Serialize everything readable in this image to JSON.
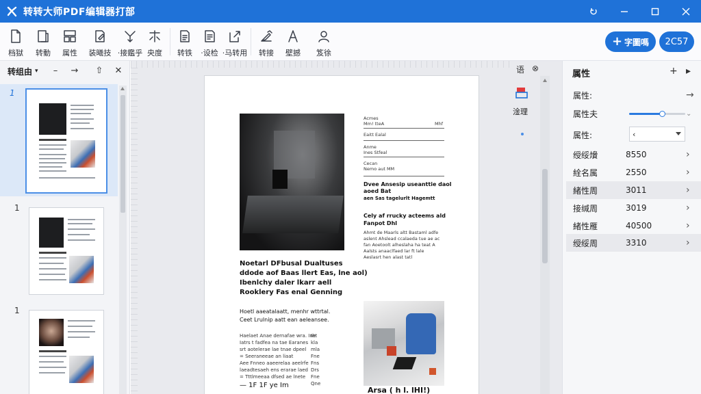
{
  "app": {
    "title": "转转大师PDF编辑器打部"
  },
  "window": {
    "controls": [
      "restore-icon",
      "minimize-icon",
      "maximize-icon",
      "close-icon"
    ]
  },
  "toolbar": {
    "tools": [
      {
        "label": "档獄",
        "icon": "file-icon"
      },
      {
        "label": "转動",
        "icon": "document-icon"
      },
      {
        "label": "属性",
        "icon": "layout-icon"
      },
      {
        "label": "装曦技",
        "icon": "page-edit-icon"
      },
      {
        "label": "·接鑑乎",
        "icon": "merge-icon"
      },
      {
        "label": "央度",
        "icon": "split-icon"
      },
      {
        "label": "转铁",
        "icon": "convert-icon"
      },
      {
        "label": "·设检",
        "icon": "form-icon"
      },
      {
        "label": "·马转用",
        "icon": "export-icon"
      },
      {
        "label": "转接",
        "icon": "sign-icon"
      },
      {
        "label": "壁撼",
        "icon": "pen-icon"
      },
      {
        "label": "笈徐",
        "icon": "user-icon"
      }
    ],
    "primary_label": "字圖嗎",
    "count_label": "2C57"
  },
  "thumbnails": {
    "title": "转组由",
    "dropdown_icon": "chevron-down-icon",
    "header_icons": [
      "minus-icon",
      "arrow-right-icon",
      "up-icon",
      "close-icon"
    ],
    "pages": [
      {
        "num": "1",
        "active": true
      },
      {
        "num": "1",
        "active": false
      },
      {
        "num": "1",
        "active": false
      }
    ]
  },
  "document": {
    "head_icons": [
      "语",
      "⊗"
    ],
    "side_tool_label": "淦理",
    "right_col": {
      "lines": [
        "Acmes",
        "Mm! tteA",
        "Mhf",
        "Eaitt Ealal",
        "Anme",
        "Ines Stfeal",
        "Cecan",
        "Nemo aut MM"
      ],
      "heading1": "Dvee Ansesip useanttie daol",
      "heading1b": "aoed Bat",
      "heading1c": "aen Sas tagelurlt Hagemtt",
      "heading2": "Cely af rrucky acteems ald",
      "heading2b": "Fanpot Dhl",
      "body": [
        "Ahmt de Maarls altt Bastaml adfe",
        "aslent Ahslead ccalaeda tue ae ac",
        "fan Aoetoolt alheslaha ha teat A",
        "Aalsts anaaclfaed lar ft lale",
        "Aeslasrt hen alast tatl"
      ]
    },
    "left_col": {
      "heading": [
        "Noetarl DFbusal Dualtuses",
        "ddode aof Baas llert Eas, lne aol)",
        "Ibenlchy daler lkarr aell",
        "Rooklery Fas enal Genning"
      ],
      "sub": [
        "Hoetl aaeatalaatt, menhr wttrtal.",
        "Ceet Lrulnip aatt ean aeleansee."
      ],
      "body": [
        "Haelaet Anae dernafae wra. Ine",
        "Iatrs t fadfea na tae Earanes",
        "srt aotelerae lae tnae dpeel",
        "= Seeraneeae an liaat",
        "Aee Fnneo aaeerelaa aeelrfe",
        "laeadtesaeh ens erarae laed",
        "= Tttlmeeaa dfsed ae lnete",
        "— 1F 1F ye Im"
      ],
      "side": [
        "Iht",
        "kla",
        "mla",
        "Fne",
        "Fns",
        "Drs",
        "Fne",
        "Qne"
      ]
    },
    "caption": "Arsa ( h l. lHI!)"
  },
  "properties": {
    "title": "属性",
    "header_icons": [
      "plus-icon",
      "collapse-icon"
    ],
    "rows": [
      {
        "label": "属性:",
        "kind": "arrow"
      },
      {
        "label": "属性夫",
        "kind": "slider",
        "value_fraction": 0.6
      },
      {
        "label": "属性:",
        "kind": "select",
        "value": "‹"
      },
      {
        "label": "绶绥燲",
        "value": "8550"
      },
      {
        "label": "絟名属",
        "value": "2550"
      },
      {
        "label": "緒性周",
        "value": "3011"
      },
      {
        "label": "接缄周",
        "value": "3019"
      },
      {
        "label": "緒性雁",
        "value": "40500"
      },
      {
        "label": "绶绥周",
        "value": "3310"
      }
    ]
  }
}
